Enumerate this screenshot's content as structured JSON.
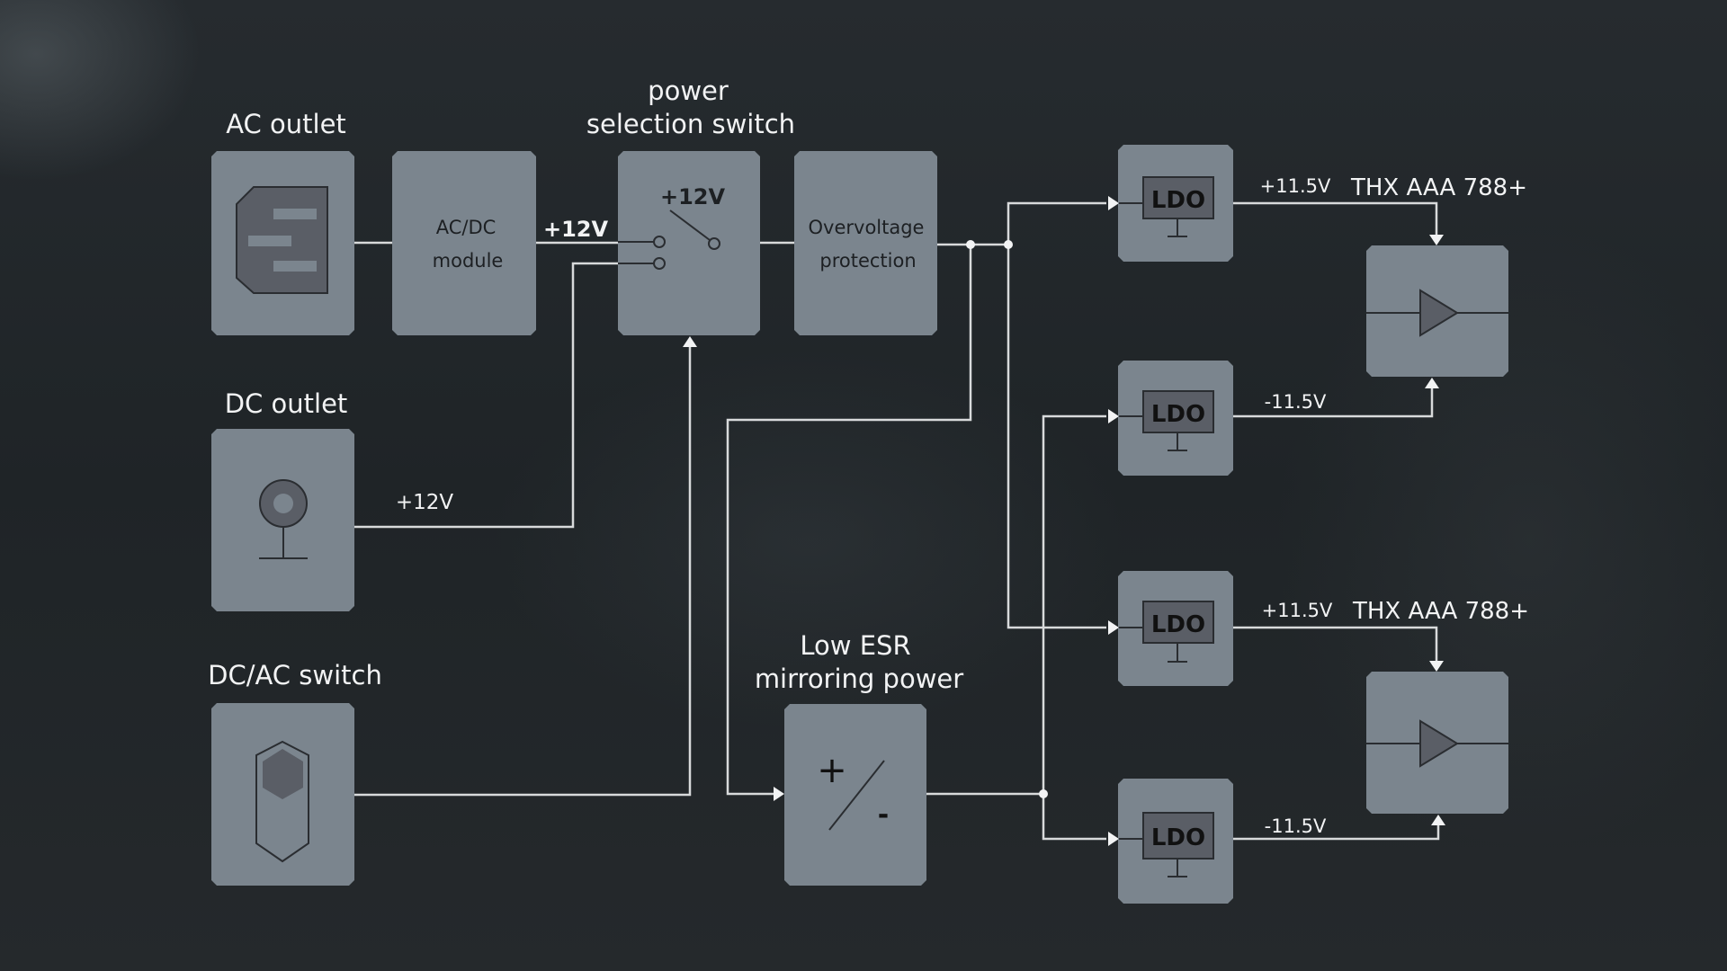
{
  "labels": {
    "ac_outlet": "AC outlet",
    "dc_outlet": "DC outlet",
    "dcac_switch": "DC/AC switch",
    "power_sel_line1": "power",
    "power_sel_line2": "selection switch",
    "low_esr_line1": "Low ESR",
    "low_esr_line2": "mirroring power",
    "amp1": "THX AAA 788+",
    "amp2": "THX AAA 788+"
  },
  "boxes": {
    "acdc_line1": "AC/DC",
    "acdc_line2": "module",
    "switch_voltage": "+12V",
    "ovp_line1": "Overvoltage",
    "ovp_line2": "protection",
    "ldo": [
      "LDO",
      "LDO",
      "LDO",
      "LDO"
    ],
    "esr_plus": "+",
    "esr_minus": "-"
  },
  "voltages": {
    "acdc_out": "+12V",
    "dc_out": "+12V",
    "ldo1_out": "+11.5V",
    "ldo2_out": "-11.5V",
    "ldo3_out": "+11.5V",
    "ldo4_out": "-11.5V"
  },
  "colors": {
    "background": "#23282c",
    "block": "#7b858e",
    "wire": "#d8dadb",
    "text": "#f2f3f4"
  }
}
